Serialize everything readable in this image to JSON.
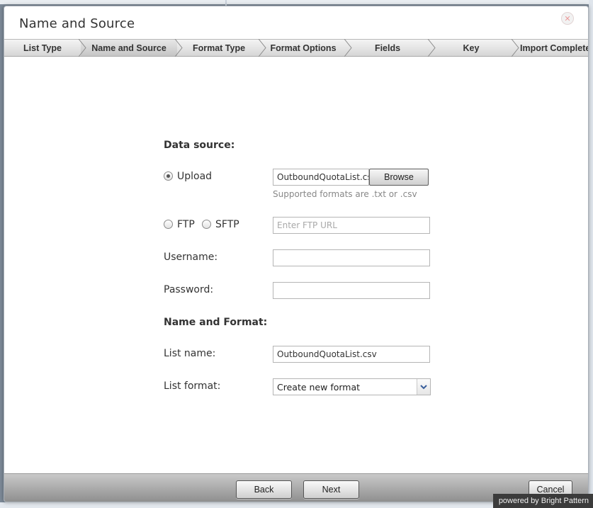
{
  "dialog": {
    "title": "Name and Source"
  },
  "steps": [
    {
      "label": "List Type",
      "active": false
    },
    {
      "label": "Name and Source",
      "active": true
    },
    {
      "label": "Format Type",
      "active": false
    },
    {
      "label": "Format Options",
      "active": false
    },
    {
      "label": "Fields",
      "active": false
    },
    {
      "label": "Key",
      "active": false
    },
    {
      "label": "Import Complete",
      "active": false
    }
  ],
  "data_source": {
    "heading": "Data source:",
    "upload_label": "Upload",
    "upload_selected": true,
    "upload_file_value": "OutboundQuotaList.csv",
    "browse_label": "Browse",
    "supported_formats_hint": "Supported formats are .txt or .csv",
    "ftp_label": "FTP",
    "sftp_label": "SFTP",
    "ftp_url_placeholder": "Enter FTP URL",
    "username_label": "Username:",
    "username_value": "",
    "password_label": "Password:",
    "password_value": ""
  },
  "name_and_format": {
    "heading": "Name and Format:",
    "list_name_label": "List name:",
    "list_name_value": "OutboundQuotaList.csv",
    "list_format_label": "List format:",
    "list_format_value": "Create new format"
  },
  "footer": {
    "back_label": "Back",
    "next_label": "Next",
    "cancel_label": "Cancel",
    "powered_by": "powered by Bright Pattern"
  },
  "colors": {
    "accent_select_arrow": "#3a5f9c",
    "close_icon": "#ec9a9a",
    "footer_bar": "#a8a8a8"
  }
}
